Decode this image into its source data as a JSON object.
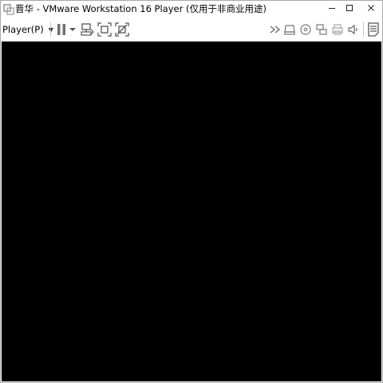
{
  "window": {
    "title": "晋华 - VMware Workstation 16 Player (仅用于非商业用途)"
  },
  "window_controls": {
    "minimize_icon": "minimize-icon",
    "maximize_icon": "maximize-icon",
    "close_icon": "close-icon"
  },
  "toolbar": {
    "player_menu_label": "Player(P)",
    "icons": [
      "pause-icon",
      "dropdown-caret-icon",
      "send-ctrl-alt-del-icon",
      "fit-guest-icon",
      "unity-icon",
      "fast-forward-icon",
      "removable-devices-icon",
      "cd-dvd-icon",
      "network-adapter-icon",
      "printer-icon",
      "sound-icon",
      "message-log-icon"
    ]
  },
  "colors": {
    "titlebar_bg": "#ffffff",
    "screen_bg": "#000000",
    "icon_gray": "#555555"
  }
}
